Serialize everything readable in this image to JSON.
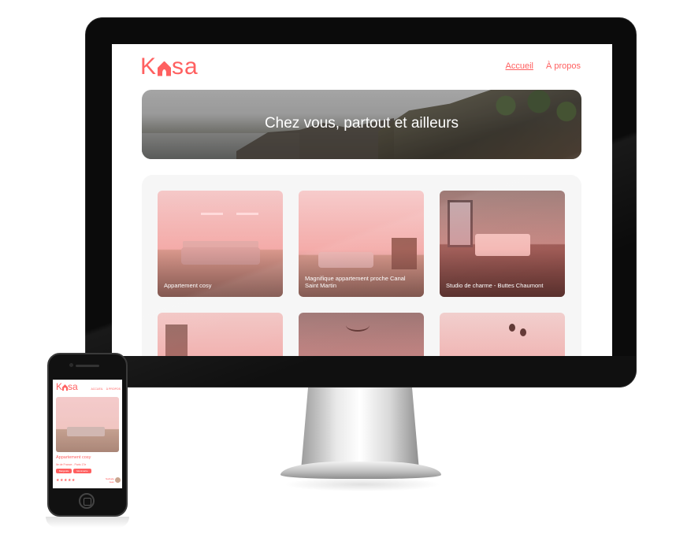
{
  "desktop": {
    "logo": {
      "prefix": "K",
      "suffix": "sa"
    },
    "nav": [
      {
        "label": "Accueil"
      },
      {
        "label": "À propos"
      }
    ],
    "banner_title": "Chez vous, partout et ailleurs",
    "cards": [
      {
        "title": "Appartement cosy"
      },
      {
        "title": "Magnifique appartement proche Canal Saint Martin"
      },
      {
        "title": "Studio de charme - Buttes Chaumont"
      },
      {
        "title": ""
      },
      {
        "title": ""
      },
      {
        "title": ""
      }
    ]
  },
  "mobile": {
    "logo": {
      "prefix": "K",
      "suffix": "sa"
    },
    "nav": [
      {
        "label": "Accueil"
      },
      {
        "label": "À propos"
      }
    ],
    "listing_title": "Appartement cosy",
    "location": "Ile de France - Paris 17e",
    "tags": [
      "Batignolle",
      "Montmartre"
    ],
    "stars": "★★★★★",
    "host_first": "Nathalie",
    "host_last": "Jean"
  },
  "colors": {
    "brand": "#ff6060",
    "gallery_bg": "#f6f6f6"
  }
}
